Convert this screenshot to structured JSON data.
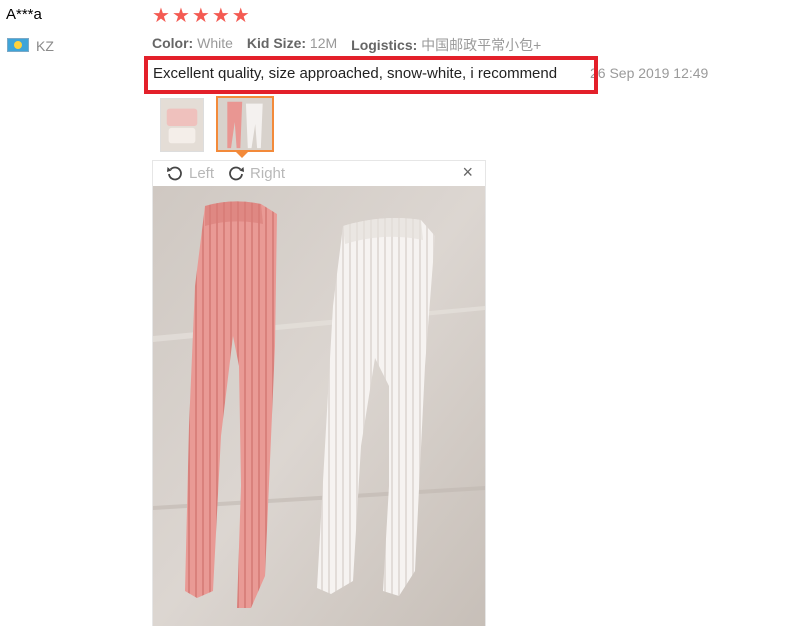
{
  "buyer": {
    "name": "A***a",
    "country": "KZ",
    "flag_icon": "kazakhstan-flag-icon"
  },
  "rating": {
    "stars": 5,
    "max": 5,
    "star_glyph": "★"
  },
  "attributes": [
    {
      "label": "Color:",
      "value": "White"
    },
    {
      "label": "Kid Size:",
      "value": "12M"
    },
    {
      "label": "Logistics:",
      "value": "中国邮政平常小包+"
    }
  ],
  "review": {
    "text": "Excellent quality, size approached, snow-white, i recommend",
    "date": "26 Sep 2019 12:49"
  },
  "viewer": {
    "rotate_left_label": "Left",
    "rotate_right_label": "Right",
    "close_glyph": "×"
  },
  "colors": {
    "accent": "#f45a52",
    "highlight": "#e3202a",
    "selected_thumb": "#f38a3a"
  }
}
